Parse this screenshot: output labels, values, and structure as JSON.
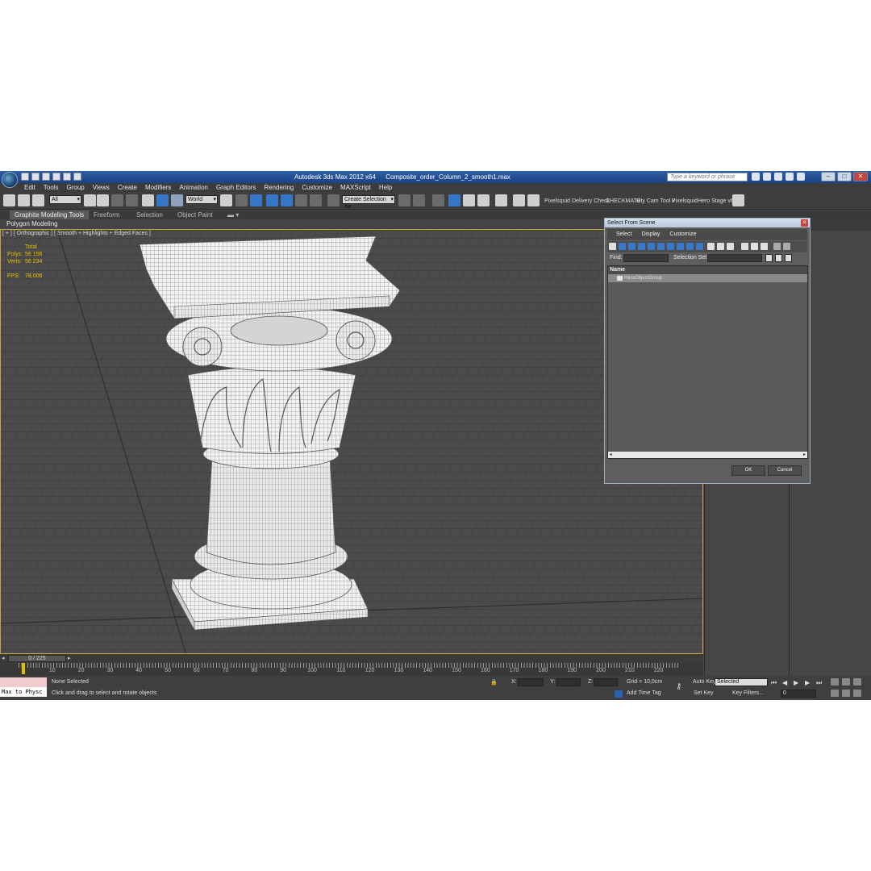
{
  "window": {
    "app_title": "Autodesk 3ds Max  2012 x64",
    "file_name": "Composite_order_Column_2_smooth1.max",
    "search_placeholder": "Type a keyword or phrase",
    "min": "–",
    "max": "□",
    "close": "✕"
  },
  "menu": [
    "Edit",
    "Tools",
    "Group",
    "Views",
    "Create",
    "Modifiers",
    "Animation",
    "Graph Editors",
    "Rendering",
    "Customize",
    "MAXScript",
    "Help"
  ],
  "toolbar": {
    "filter_value": "All",
    "coord_value": "World",
    "selection_set_value": "Create Selection Se",
    "plugins": [
      "Pixelsquid",
      "Delivery Check",
      "CHECKMATE",
      "uity Cam Tool v",
      "Pixelsquid",
      "Hero Stage v6"
    ]
  },
  "ribbon": {
    "tabs": [
      "Graphite Modeling Tools",
      "Freeform",
      "Selection",
      "Object Paint"
    ],
    "active_tab": "Graphite Modeling Tools",
    "sub_label": "Polygon Modeling"
  },
  "viewport": {
    "label": "[ + ] [ Orthographic ] [ Smooth + Highlights + Edged Faces ]",
    "stats": {
      "header": "Total",
      "polys_label": "Polys:",
      "polys_value": "56 156",
      "verts_label": "Verts:",
      "verts_value": "56 234",
      "fps_label": "FPS:",
      "fps_value": "78,006"
    }
  },
  "dialog": {
    "title": "Select From Scene",
    "menu": [
      "Select",
      "Display",
      "Customize"
    ],
    "find_label": "Find:",
    "selection_set_label": "Selection Set:",
    "column_name": "Name",
    "items": [
      "HeroObjectGroup"
    ],
    "ok": "OK",
    "cancel": "Cancel"
  },
  "timeline": {
    "frame": "0 / 225",
    "ticks": [
      "10",
      "20",
      "30",
      "40",
      "50",
      "60",
      "70",
      "80",
      "90",
      "100",
      "110",
      "120",
      "130",
      "140",
      "150",
      "160",
      "170",
      "180",
      "190",
      "200",
      "210",
      "220"
    ]
  },
  "status": {
    "maxscript": "Max to Physc",
    "selection": "None Selected",
    "prompt": "Click and drag to select and rotate objects",
    "x_label": "X:",
    "y_label": "Y:",
    "z_label": "Z:",
    "grid": "Grid = 10,0cm",
    "add_time_tag": "Add Time Tag",
    "auto_key": "Auto Key",
    "key_mode_value": "Selected",
    "set_key": "Set Key",
    "key_filters": "Key Filters...",
    "current_frame": "0"
  }
}
